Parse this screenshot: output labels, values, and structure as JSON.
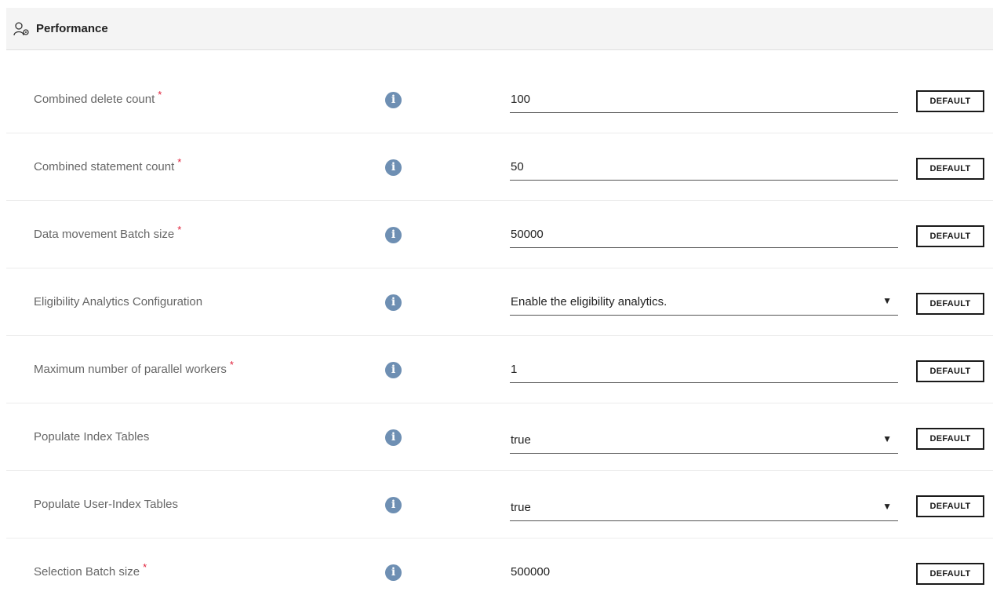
{
  "section": {
    "title": "Performance",
    "icon": "user-settings-icon"
  },
  "default_label": "DEFAULT",
  "rows": [
    {
      "label": "Combined delete count",
      "required": "*",
      "value": "100",
      "type": "input"
    },
    {
      "label": "Combined statement count",
      "required": "*",
      "value": "50",
      "type": "input"
    },
    {
      "label": "Data movement Batch size",
      "required": "*",
      "value": "50000",
      "type": "input"
    },
    {
      "label": "Eligibility Analytics Configuration",
      "required": "",
      "value": "Enable the eligibility analytics.",
      "type": "select"
    },
    {
      "label": "Maximum number of parallel workers",
      "required": "*",
      "value": "1",
      "type": "input"
    },
    {
      "label": "Populate Index Tables",
      "required": "",
      "value": "true",
      "type": "select"
    },
    {
      "label": "Populate User-Index Tables",
      "required": "",
      "value": "true",
      "type": "select"
    },
    {
      "label": "Selection Batch size",
      "required": "*",
      "value": "500000",
      "type": "input"
    }
  ],
  "colors": {
    "info_icon": "#6e8fb3",
    "required_marker": "#e0203a",
    "header_bg": "#f4f4f4"
  }
}
